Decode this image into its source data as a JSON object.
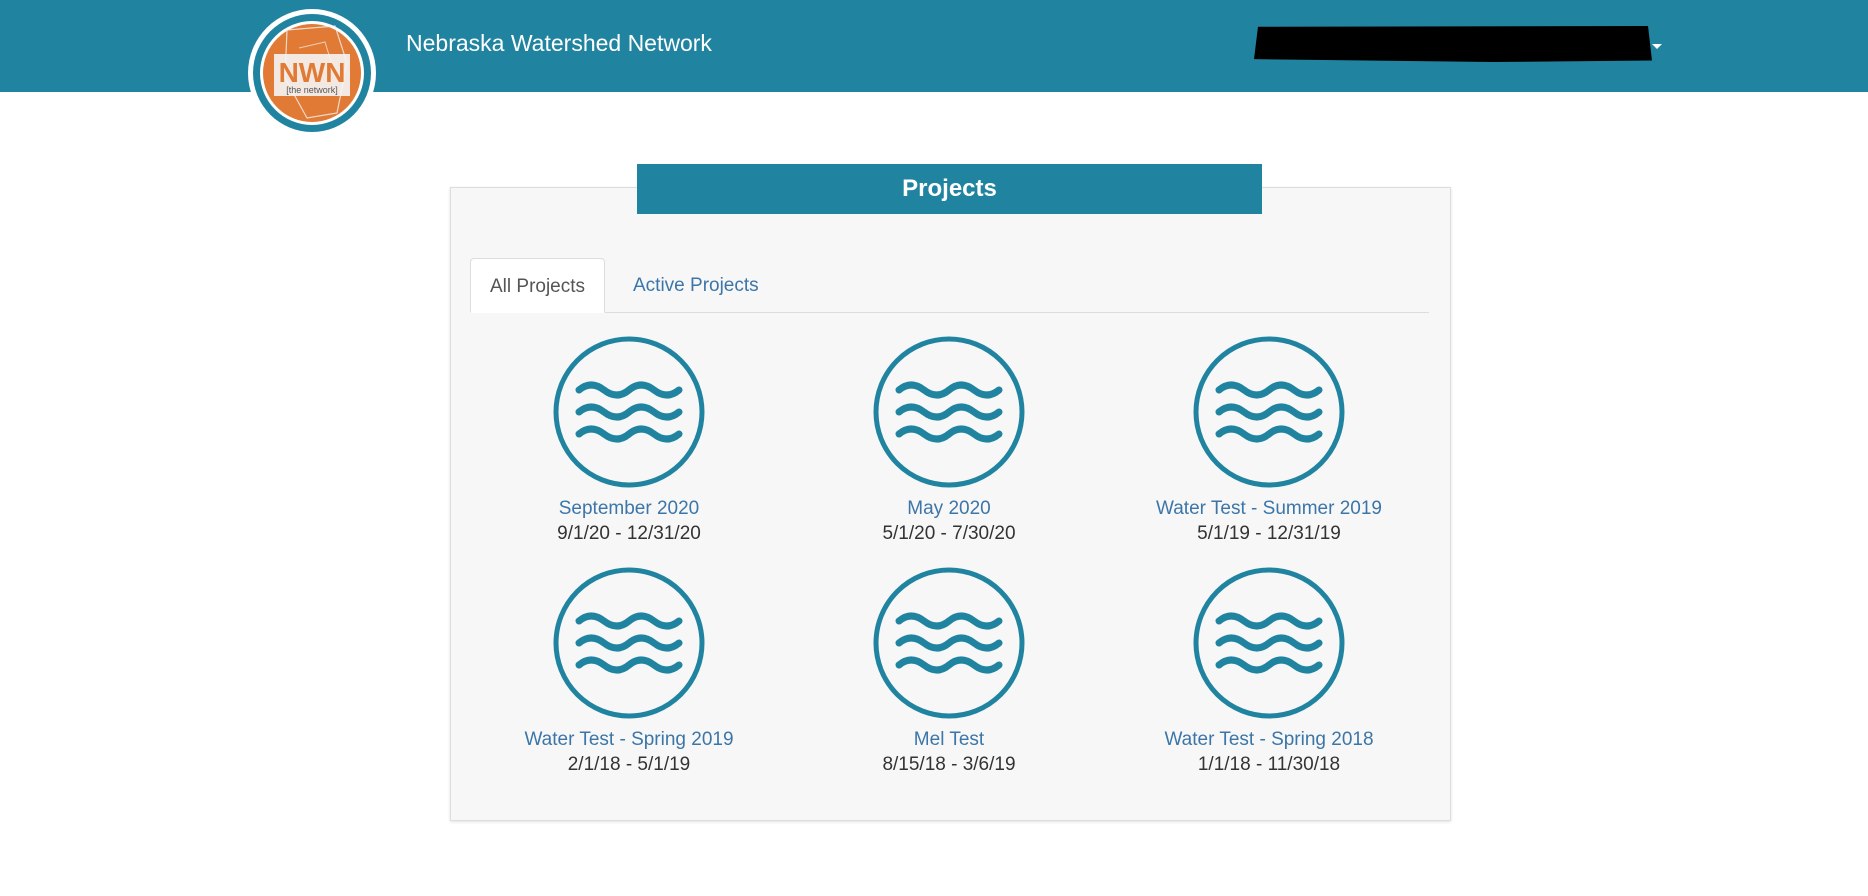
{
  "header": {
    "brand": "Nebraska Watershed Network",
    "logo": {
      "main_text": "NWN",
      "sub_text": "[the network]"
    },
    "colors": {
      "bar": "#2084a1",
      "logo_orange": "#e07a34"
    }
  },
  "panel": {
    "title": "Projects",
    "tabs": [
      {
        "label": "All Projects",
        "active": true
      },
      {
        "label": "Active Projects",
        "active": false
      }
    ],
    "projects": [
      {
        "name": "September 2020",
        "dates": "9/1/20 - 12/31/20",
        "icon": "water-waves-icon"
      },
      {
        "name": "May 2020",
        "dates": "5/1/20 - 7/30/20",
        "icon": "water-waves-icon"
      },
      {
        "name": "Water Test - Summer 2019",
        "dates": "5/1/19 - 12/31/19",
        "icon": "water-waves-icon"
      },
      {
        "name": "Water Test - Spring 2019",
        "dates": "2/1/18 - 5/1/19",
        "icon": "water-waves-icon"
      },
      {
        "name": "Mel Test",
        "dates": "8/15/18 - 3/6/19",
        "icon": "water-waves-icon"
      },
      {
        "name": "Water Test - Spring 2018",
        "dates": "1/1/18 - 11/30/18",
        "icon": "water-waves-icon"
      }
    ]
  }
}
